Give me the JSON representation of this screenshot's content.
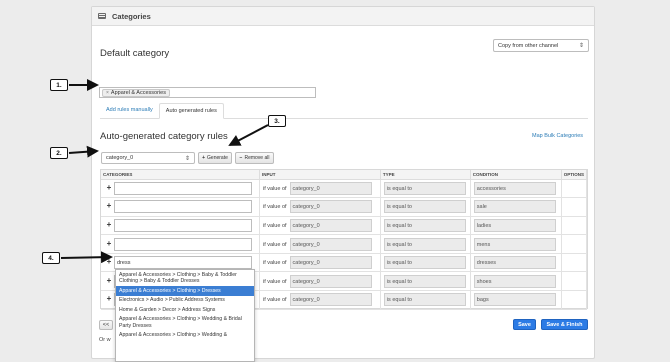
{
  "panel": {
    "title": "Categories",
    "header_icon": "list-icon"
  },
  "default_category": {
    "heading": "Default category",
    "copy_select": "Copy from other channel",
    "tag": "Apparel & Accessories"
  },
  "tabs": [
    {
      "label": "Add rules manually",
      "active": false
    },
    {
      "label": "Auto generated rules",
      "active": true
    }
  ],
  "auto": {
    "heading": "Auto-generated category rules",
    "map_link": "Map Bulk Categories",
    "select_value": "category_0",
    "generate_label": "Generate",
    "remove_label": "Remove all"
  },
  "table": {
    "columns": [
      "CATEGORIES",
      "INPUT",
      "TYPE",
      "CONDITION",
      "OPTIONS"
    ],
    "rows": [
      {
        "category": "",
        "if_value": "if value of",
        "input": "category_0",
        "type": "is equal to",
        "condition": "accessories"
      },
      {
        "category": "",
        "if_value": "if value of",
        "input": "category_0",
        "type": "is equal to",
        "condition": "sale"
      },
      {
        "category": "",
        "if_value": "if value of",
        "input": "category_0",
        "type": "is equal to",
        "condition": "ladies"
      },
      {
        "category": "",
        "if_value": "if value of",
        "input": "category_0",
        "type": "is equal to",
        "condition": "mens"
      },
      {
        "category": "dress",
        "if_value": "if value of",
        "input": "category_0",
        "type": "is equal to",
        "condition": "dresses"
      },
      {
        "category": "",
        "if_value": "if value of",
        "input": "category_0",
        "type": "is equal to",
        "condition": "shoes"
      },
      {
        "category": "",
        "if_value": "if value of",
        "input": "category_0",
        "type": "is equal to",
        "condition": "bags"
      }
    ]
  },
  "dropdown": {
    "items": [
      "Apparel & Accessories > Clothing > Baby & Toddler Clothing > Baby & Toddler Dresses",
      "Apparel & Accessories > Clothing > Dresses",
      "Electronics > Audio > Public Address Systems",
      "Home & Garden > Decor > Address Signs",
      "Apparel & Accessories > Clothing > Wedding & Bridal Party Dresses",
      "Apparel & Accessories > Clothing > Wedding &"
    ],
    "selected_index": 1
  },
  "footer": {
    "prev_label": "<<",
    "or_text": "Or w",
    "save_label": "Save",
    "save_finish_label": "Save & Finish"
  },
  "callouts": [
    "1.",
    "2.",
    "3.",
    "4."
  ]
}
